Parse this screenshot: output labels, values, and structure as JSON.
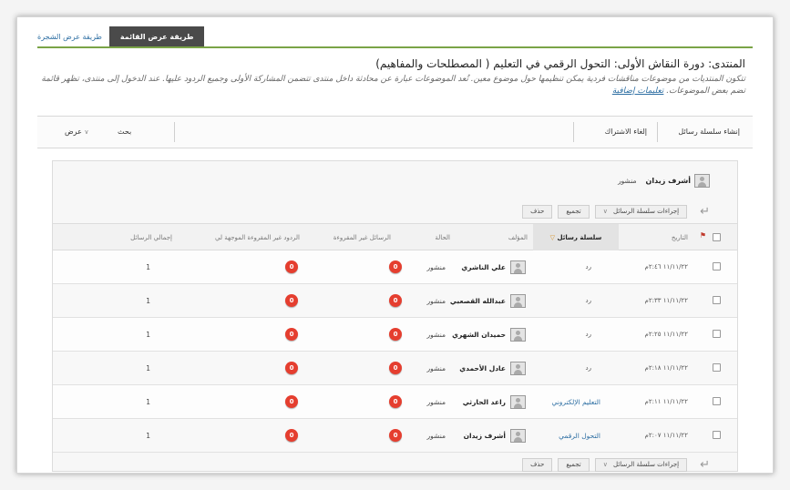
{
  "view_tabs": {
    "tree_view": "طريقة عرض الشجرة",
    "list_view": "طريقة عرض القائمة"
  },
  "forum": {
    "title": "المنتدى: دورة النقاش الأولى: التحول الرقمي في التعليم ( المصطلحات والمفاهيم)",
    "description": "تتكون المنتديات من موضوعات مناقشات فردية يمكن تنظيمها حول موضوع معين. تُعد الموضوعات عبارة عن محادثة داخل منتدى تتضمن المشاركة الأولى وجميع الردود عليها. عند الدخول إلى منتدى، تظهر قائمة تضم بعض الموضوعات.",
    "more_help": "تعليمات إضافية"
  },
  "action_bar": {
    "create_thread": "إنشاء سلسلة رسائل",
    "unsubscribe": "إلغاء الاشتراك",
    "search": "بحث",
    "display": "عرض"
  },
  "author_chip": {
    "name": "أشرف زيدان",
    "status": "منشور"
  },
  "thread_actions": {
    "thread_actions": "إجراءات سلسلة الرسائل",
    "collect": "تجميع",
    "delete": "حذف"
  },
  "table": {
    "headers": {
      "date": "التاريخ",
      "thread": "سلسلة رسائل",
      "author": "المؤلف",
      "status": "الحالة",
      "unread": "الرسائل غير المقروءة",
      "unread_replies": "الردود غير المقروءة الموجهة لي",
      "total": "إجمالي الرسائل"
    },
    "rows": [
      {
        "date": "١١/١١/٢٢",
        "time": "٢:٤٦م",
        "subject": "رد",
        "author": "علي الناشري",
        "status": "منشور",
        "unread": "0",
        "unread_replies": "0",
        "total": "1"
      },
      {
        "date": "١١/١١/٢٢",
        "time": "٢:٣٣م",
        "subject": "رد",
        "author": "عبدالله القصعبي",
        "status": "منشور",
        "unread": "0",
        "unread_replies": "0",
        "total": "1"
      },
      {
        "date": "١١/١١/٢٢",
        "time": "٢:٢٥م",
        "subject": "رد",
        "author": "حميدان الشهري",
        "status": "منشور",
        "unread": "0",
        "unread_replies": "0",
        "total": "1"
      },
      {
        "date": "١١/١١/٢٢",
        "time": "٢:١٨م",
        "subject": "رد",
        "author": "عادل الأحمدي",
        "status": "منشور",
        "unread": "0",
        "unread_replies": "0",
        "total": "1"
      },
      {
        "date": "١١/١١/٢٢",
        "time": "٢:١١م",
        "subject": "التعليم الإلكتروني",
        "author": "راعد الحارثي",
        "status": "منشور",
        "unread": "0",
        "unread_replies": "0",
        "total": "1"
      },
      {
        "date": "١١/١١/٢٢",
        "time": "٢:٠٧م",
        "subject": "التحول الرقمي",
        "author": "أشرف زيدان",
        "status": "منشور",
        "unread": "0",
        "unread_replies": "0",
        "total": "1"
      }
    ]
  },
  "colors": {
    "accent_green": "#7aa447",
    "badge_red": "#e53e2f",
    "link_blue": "#2e6fa3",
    "flag_red": "#c0392b"
  },
  "icons": [
    "avatar-icon",
    "sort-down-icon",
    "flag-icon",
    "return-arrow-icon",
    "chevron-down-icon"
  ]
}
